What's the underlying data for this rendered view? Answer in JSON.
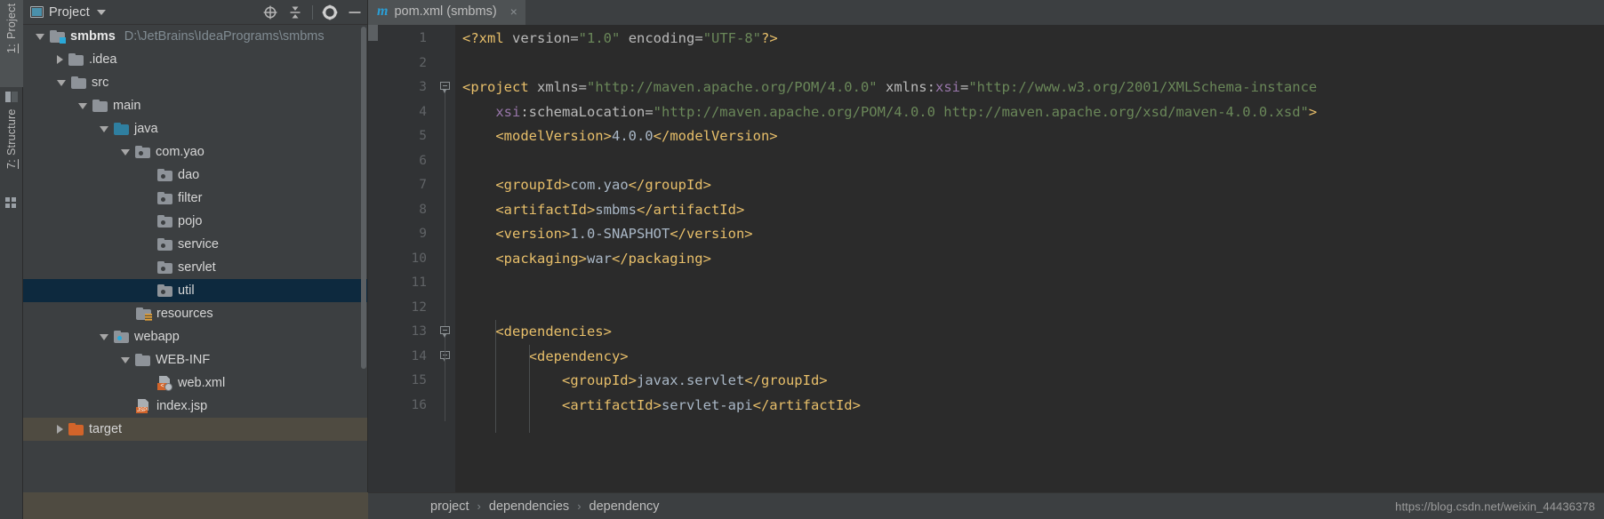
{
  "toolwindow_bar": {
    "project_button": {
      "number": "1:",
      "label": "Project"
    },
    "structure_button": {
      "number": "7:",
      "label": "Structure"
    },
    "icons": {
      "panel": "panel-layout-icon",
      "grid": "grid-icon"
    }
  },
  "project_panel": {
    "title": "Project",
    "icons": {
      "view_mode": "project-view-icon",
      "dropdown": "chevron-down-icon",
      "locate": "target-crosshair-icon",
      "collapse_all": "collapse-all-icon",
      "settings": "gear-icon",
      "hide": "minimize-icon"
    },
    "tree": [
      {
        "label": "smbms",
        "path": "D:\\JetBrains\\IdeaPrograms\\smbms",
        "indent": 0,
        "arrow": "down",
        "icon": "module-folder",
        "bold": true,
        "state": "normal"
      },
      {
        "label": ".idea",
        "path": "",
        "indent": 1,
        "arrow": "right",
        "icon": "folder",
        "bold": false,
        "state": "normal"
      },
      {
        "label": "src",
        "path": "",
        "indent": 1,
        "arrow": "down",
        "icon": "folder",
        "bold": false,
        "state": "normal"
      },
      {
        "label": "main",
        "path": "",
        "indent": 2,
        "arrow": "down",
        "icon": "folder",
        "bold": false,
        "state": "normal"
      },
      {
        "label": "java",
        "path": "",
        "indent": 3,
        "arrow": "down",
        "icon": "source-folder",
        "bold": false,
        "state": "normal"
      },
      {
        "label": "com.yao",
        "path": "",
        "indent": 4,
        "arrow": "down",
        "icon": "package",
        "bold": false,
        "state": "normal"
      },
      {
        "label": "dao",
        "path": "",
        "indent": 5,
        "arrow": "none",
        "icon": "package",
        "bold": false,
        "state": "normal"
      },
      {
        "label": "filter",
        "path": "",
        "indent": 5,
        "arrow": "none",
        "icon": "package",
        "bold": false,
        "state": "normal"
      },
      {
        "label": "pojo",
        "path": "",
        "indent": 5,
        "arrow": "none",
        "icon": "package",
        "bold": false,
        "state": "normal"
      },
      {
        "label": "service",
        "path": "",
        "indent": 5,
        "arrow": "none",
        "icon": "package",
        "bold": false,
        "state": "normal"
      },
      {
        "label": "servlet",
        "path": "",
        "indent": 5,
        "arrow": "none",
        "icon": "package",
        "bold": false,
        "state": "normal"
      },
      {
        "label": "util",
        "path": "",
        "indent": 5,
        "arrow": "none",
        "icon": "package",
        "bold": false,
        "state": "selected"
      },
      {
        "label": "resources",
        "path": "",
        "indent": 4,
        "arrow": "none",
        "icon": "resources-folder",
        "bold": false,
        "state": "normal"
      },
      {
        "label": "webapp",
        "path": "",
        "indent": 3,
        "arrow": "down",
        "icon": "webapp-folder",
        "bold": false,
        "state": "normal"
      },
      {
        "label": "WEB-INF",
        "path": "",
        "indent": 4,
        "arrow": "down",
        "icon": "folder",
        "bold": false,
        "state": "normal"
      },
      {
        "label": "web.xml",
        "path": "",
        "indent": 5,
        "arrow": "none",
        "icon": "web-xml-file",
        "bold": false,
        "state": "normal"
      },
      {
        "label": "index.jsp",
        "path": "",
        "indent": 4,
        "arrow": "none",
        "icon": "jsp-file",
        "bold": false,
        "state": "normal"
      },
      {
        "label": "target",
        "path": "",
        "indent": 1,
        "arrow": "right",
        "icon": "target-folder",
        "bold": false,
        "state": "highlight"
      }
    ]
  },
  "editor": {
    "tab": {
      "label": "pom.xml (smbms)",
      "icon_glyph": "m",
      "close_glyph": "×"
    },
    "line_numbers": [
      "1",
      "2",
      "3",
      "4",
      "5",
      "6",
      "7",
      "8",
      "9",
      "10",
      "11",
      "12",
      "13",
      "14",
      "15",
      "16"
    ],
    "lines": [
      {
        "n": 1,
        "indent": 0,
        "tokens": [
          {
            "t": "<?xml ",
            "c": "pi"
          },
          {
            "t": "version",
            "c": "attr"
          },
          {
            "t": "=",
            "c": "attr"
          },
          {
            "t": "\"1.0\"",
            "c": "str"
          },
          {
            "t": " ",
            "c": "attr"
          },
          {
            "t": "encoding",
            "c": "attr"
          },
          {
            "t": "=",
            "c": "attr"
          },
          {
            "t": "\"UTF-8\"",
            "c": "str"
          },
          {
            "t": "?>",
            "c": "pi"
          }
        ]
      },
      {
        "n": 2,
        "indent": 0,
        "tokens": []
      },
      {
        "n": 3,
        "indent": 0,
        "tokens": [
          {
            "t": "<project ",
            "c": "tag"
          },
          {
            "t": "xmlns",
            "c": "attr"
          },
          {
            "t": "=",
            "c": "attr"
          },
          {
            "t": "\"http://maven.apache.org/POM/4.0.0\"",
            "c": "str"
          },
          {
            "t": " ",
            "c": "attr"
          },
          {
            "t": "xmlns:",
            "c": "attr"
          },
          {
            "t": "xsi",
            "c": "ns"
          },
          {
            "t": "=",
            "c": "attr"
          },
          {
            "t": "\"http://www.w3.org/2001/XMLSchema-instance",
            "c": "str"
          }
        ]
      },
      {
        "n": 4,
        "indent": 1,
        "tokens": [
          {
            "t": "xsi",
            "c": "ns"
          },
          {
            "t": ":schemaLocation",
            "c": "attr"
          },
          {
            "t": "=",
            "c": "attr"
          },
          {
            "t": "\"http://maven.apache.org/POM/4.0.0 http://maven.apache.org/xsd/maven-4.0.0.xsd\"",
            "c": "str"
          },
          {
            "t": ">",
            "c": "tag"
          }
        ]
      },
      {
        "n": 5,
        "indent": 1,
        "tokens": [
          {
            "t": "<modelVersion>",
            "c": "tag"
          },
          {
            "t": "4.0.0",
            "c": "txt"
          },
          {
            "t": "</modelVersion>",
            "c": "tag"
          }
        ]
      },
      {
        "n": 6,
        "indent": 1,
        "tokens": []
      },
      {
        "n": 7,
        "indent": 1,
        "tokens": [
          {
            "t": "<groupId>",
            "c": "tag"
          },
          {
            "t": "com.yao",
            "c": "txt"
          },
          {
            "t": "</groupId>",
            "c": "tag"
          }
        ]
      },
      {
        "n": 8,
        "indent": 1,
        "tokens": [
          {
            "t": "<artifactId>",
            "c": "tag"
          },
          {
            "t": "smbms",
            "c": "txt"
          },
          {
            "t": "</artifactId>",
            "c": "tag"
          }
        ]
      },
      {
        "n": 9,
        "indent": 1,
        "tokens": [
          {
            "t": "<version>",
            "c": "tag"
          },
          {
            "t": "1.0-SNAPSHOT",
            "c": "txt"
          },
          {
            "t": "</version>",
            "c": "tag"
          }
        ]
      },
      {
        "n": 10,
        "indent": 1,
        "tokens": [
          {
            "t": "<packaging>",
            "c": "tag"
          },
          {
            "t": "war",
            "c": "txt"
          },
          {
            "t": "</packaging>",
            "c": "tag"
          }
        ]
      },
      {
        "n": 11,
        "indent": 1,
        "tokens": []
      },
      {
        "n": 12,
        "indent": 1,
        "tokens": []
      },
      {
        "n": 13,
        "indent": 1,
        "tokens": [
          {
            "t": "<dependencies>",
            "c": "tag"
          }
        ]
      },
      {
        "n": 14,
        "indent": 2,
        "tokens": [
          {
            "t": "<dependency>",
            "c": "tag"
          }
        ]
      },
      {
        "n": 15,
        "indent": 3,
        "tokens": [
          {
            "t": "<groupId>",
            "c": "tag"
          },
          {
            "t": "javax.servlet",
            "c": "txt"
          },
          {
            "t": "</groupId>",
            "c": "tag"
          }
        ]
      },
      {
        "n": 16,
        "indent": 3,
        "tokens": [
          {
            "t": "<artifactId>",
            "c": "tag"
          },
          {
            "t": "servlet-api",
            "c": "txt"
          },
          {
            "t": "</artifactId>",
            "c": "tag"
          }
        ]
      }
    ],
    "fold_markers": [
      13,
      14
    ]
  },
  "breadcrumbs": [
    "project",
    "dependencies",
    "dependency"
  ],
  "breadcrumb_separator": "›",
  "watermark": "https://blog.csdn.net/weixin_44436378",
  "colors": {
    "panel_bg": "#3c3f41",
    "editor_bg": "#2b2b2b",
    "gutter_bg": "#313335",
    "selection": "#0d293e",
    "highlight": "#4f4b41",
    "tag": "#e8bf6a",
    "string": "#6a8759",
    "text": "#a9b7c6",
    "namespace": "#9876aa",
    "attribute": "#bababa",
    "line_number": "#606366",
    "accent_blue": "#2a9fd6",
    "orange": "#d2642a"
  }
}
